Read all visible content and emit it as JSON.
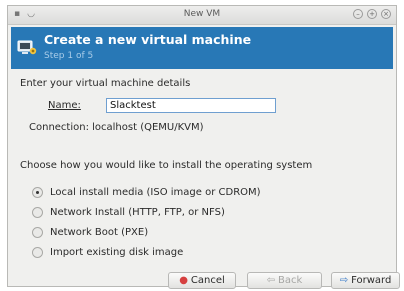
{
  "window": {
    "title": "New VM"
  },
  "header": {
    "title": "Create a new virtual machine",
    "step": "Step 1 of 5"
  },
  "details": {
    "heading": "Enter your virtual machine details",
    "name_label": "Name:",
    "name_value": "Slacktest",
    "connection_text": "Connection: localhost (QEMU/KVM)"
  },
  "install": {
    "heading": "Choose how you would like to install the operating system",
    "options": [
      {
        "label": "Local install media (ISO image or CDROM)",
        "selected": true
      },
      {
        "label": "Network Install (HTTP, FTP, or NFS)",
        "selected": false
      },
      {
        "label": "Network Boot (PXE)",
        "selected": false
      },
      {
        "label": "Import existing disk image",
        "selected": false
      }
    ]
  },
  "buttons": {
    "cancel": "Cancel",
    "back": "Back",
    "forward": "Forward"
  },
  "colors": {
    "banner": "#2878b6",
    "cancel_icon": "#d64040",
    "forward_icon": "#3a7bc8"
  }
}
